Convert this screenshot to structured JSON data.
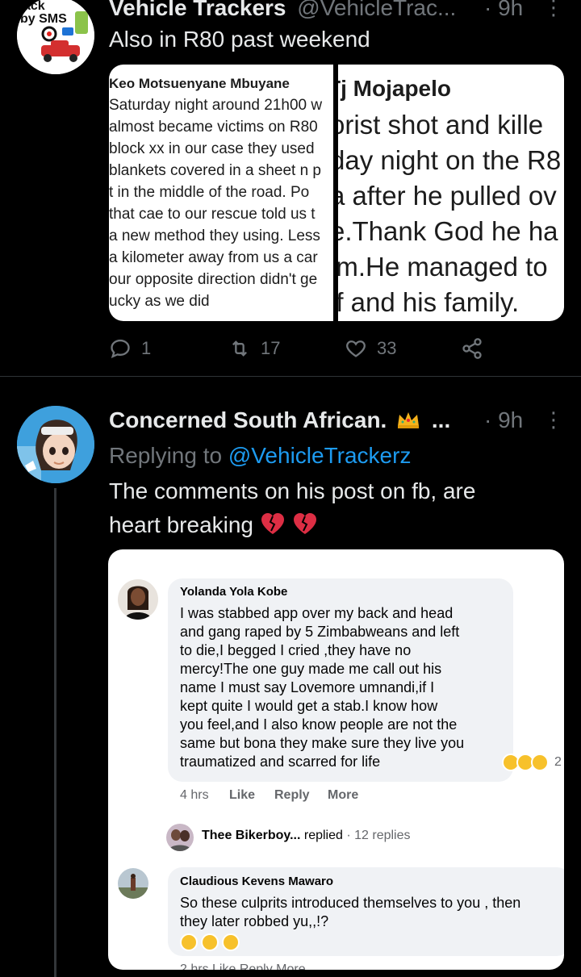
{
  "tweet1": {
    "author_name": "Vehicle Trackers",
    "handle": "@VehicleTrac...",
    "time": "· 9h",
    "avatar_text": [
      "ack",
      "by SMS"
    ],
    "text": "Also in R80 past weekend",
    "image_left": {
      "header": "Keo Motsuenyane Mbuyane",
      "lines": [
        "Saturday night around 21h00 w",
        "almost became victims on R80",
        "block xx in our case they used",
        "blankets covered in a sheet n p",
        "t in the middle of the road. Po",
        "that cae to our rescue told us t",
        "a new method they using. Less",
        "a kilometer away from us a car",
        "our opposite direction didn't ge",
        "ucky as we did"
      ]
    },
    "image_right": {
      "header": "Tj Mojapelo",
      "lines": [
        "orist shot and kille",
        "day night on the R8",
        "a after he pulled ov",
        "e.Thank God he ha",
        "im.He managed to",
        "lf and his family."
      ]
    },
    "replies": "1",
    "retweets": "17",
    "likes": "33"
  },
  "tweet2": {
    "author_name": "Concerned South African.",
    "name_suffix": "...",
    "time": "· 9h",
    "replying_prefix": "Replying to",
    "replying_handle": "@VehicleTrackerz",
    "text_lines": [
      "The comments on his post on fb, are",
      "heart breaking"
    ],
    "fb": {
      "comment1": {
        "name": "Yolanda Yola Kobe",
        "lines": [
          "I was stabbed app over my back and head",
          "and gang raped by 5 Zimbabweans and left",
          "to die,I begged I cried ,they have no",
          "mercy!The one guy made me call out his",
          "name I must say Lovemore umnandi,if I",
          "kept quite I would get a stab.I know how",
          "you feel,and I also know people are not the",
          "same but bona they make sure they live you",
          "traumatized and scarred for life"
        ],
        "reaction_count": "2",
        "time": "4 hrs",
        "like": "Like",
        "reply": "Reply",
        "more": "More"
      },
      "replied_row": {
        "name": "Thee Bikerboy...",
        "verb": "replied",
        "count": "· 12 replies"
      },
      "comment2": {
        "name": "Claudious Kevens Mawaro",
        "lines": [
          "So these culprits introduced themselves to you , then",
          "they later robbed yu,,!?"
        ],
        "meta_partial": "2 hrs    Like    Reply    More"
      }
    }
  },
  "colors": {
    "background": "#000000",
    "text": "#e7e9ea",
    "secondary": "#71767b",
    "link": "#1d9bf0",
    "fb_bubble": "#f0f2f5"
  }
}
